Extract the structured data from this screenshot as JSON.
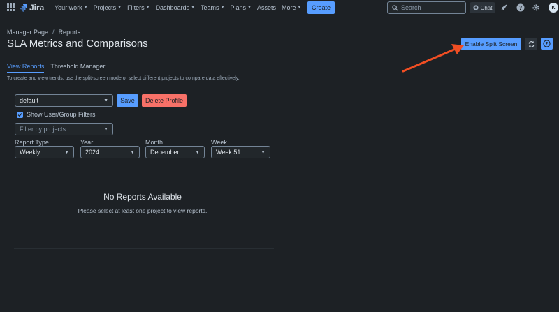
{
  "app": {
    "name": "Jira"
  },
  "nav": {
    "items": [
      {
        "label": "Your work",
        "has_dropdown": true
      },
      {
        "label": "Projects",
        "has_dropdown": true
      },
      {
        "label": "Filters",
        "has_dropdown": true
      },
      {
        "label": "Dashboards",
        "has_dropdown": true
      },
      {
        "label": "Teams",
        "has_dropdown": true
      },
      {
        "label": "Plans",
        "has_dropdown": true
      },
      {
        "label": "Assets",
        "has_dropdown": false
      },
      {
        "label": "More",
        "has_dropdown": true
      }
    ],
    "create_label": "Create",
    "search_placeholder": "Search",
    "chat_label": "Chat",
    "avatar_initial": "K"
  },
  "page": {
    "breadcrumb": [
      "Manager Page",
      "Reports"
    ],
    "title": "SLA Metrics and Comparisons",
    "split_screen_label": "Enable Split Screen",
    "tabs": [
      {
        "label": "View Reports",
        "active": true
      },
      {
        "label": "Threshold Manager",
        "active": false
      }
    ],
    "hint": "To create and view trends, use the split-screen mode or select different projects to compare data effectively."
  },
  "form": {
    "profile_value": "default",
    "save_label": "Save",
    "delete_label": "Delete Profile",
    "show_filters_label": "Show User/Group Filters",
    "show_filters_checked": true,
    "project_filter_placeholder": "Filter by projects",
    "report_type": {
      "label": "Report Type",
      "value": "Weekly"
    },
    "year": {
      "label": "Year",
      "value": "2024"
    },
    "month": {
      "label": "Month",
      "value": "December"
    },
    "week": {
      "label": "Week",
      "value": "Week 51"
    }
  },
  "empty_state": {
    "title": "No Reports Available",
    "description": "Please select at least one project to view reports."
  },
  "colors": {
    "background": "#1d2125",
    "accent": "#579dff",
    "danger": "#f87168",
    "annotation_arrow": "#f04e23"
  },
  "icons": [
    "app-switcher-icon",
    "jira-logo-icon",
    "search-icon",
    "chat-icon",
    "notifications-icon",
    "help-icon",
    "settings-icon",
    "refresh-icon",
    "info-icon",
    "chevron-down-icon",
    "checkmark-icon"
  ]
}
